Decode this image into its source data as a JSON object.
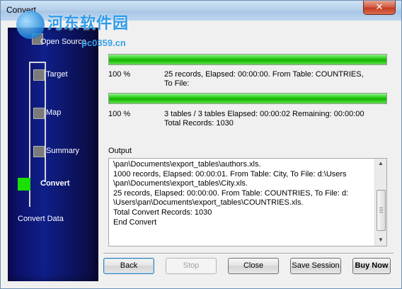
{
  "window": {
    "title": "Convert",
    "close_label": "✕"
  },
  "watermark": {
    "line1": "河东软件园",
    "line2": "pc0359.cn"
  },
  "sidebar": {
    "steps": [
      {
        "label": "Open Source"
      },
      {
        "label": "Target"
      },
      {
        "label": "Map"
      },
      {
        "label": "Summary"
      },
      {
        "label": "Convert"
      }
    ],
    "footer": "Convert Data"
  },
  "progress1": {
    "percent_value": 100,
    "percent": "100 %",
    "line1": "25 records,    Elapsed: 00:00:00.    From Table: COUNTRIES,",
    "line2": "To File:"
  },
  "progress2": {
    "percent_value": 100,
    "percent": "100 %",
    "line1": "3 tables / 3 tables    Elapsed: 00:00:02    Remaining: 00:00:00",
    "line2": "Total Records: 1030"
  },
  "output": {
    "label": "Output",
    "lines": [
      "\\pan\\Documents\\export_tables\\authors.xls.",
      "1000 records,    Elapsed: 00:00:01.    From Table: City,    To File: d:\\Users",
      "\\pan\\Documents\\export_tables\\City.xls.",
      "25 records,    Elapsed: 00:00:00.    From Table: COUNTRIES,    To File: d:",
      "\\Users\\pan\\Documents\\export_tables\\COUNTRIES.xls.",
      "Total Convert Records: 1030",
      "End Convert"
    ]
  },
  "buttons": {
    "back": "Back",
    "stop": "Stop",
    "close": "Close",
    "save_session": "Save Session",
    "buy_now": "Buy Now"
  },
  "colors": {
    "progress_green": "#13b400",
    "active_step": "#19e000",
    "sidebar_bg": "#0f1f8a"
  }
}
